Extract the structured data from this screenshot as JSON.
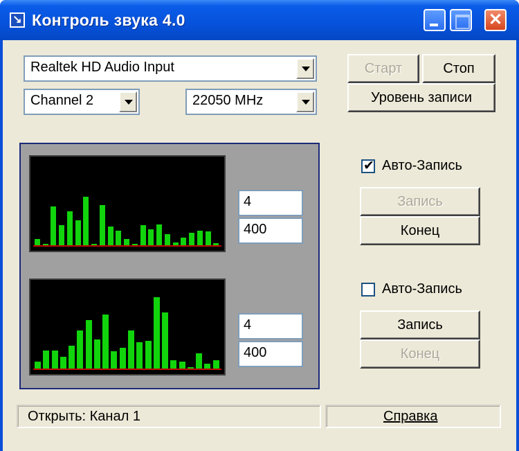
{
  "window": {
    "title": "Контроль звука 4.0",
    "app_icon_glyph": "↘",
    "close_glyph": "✕"
  },
  "device": {
    "selected": "Realtek HD Audio Input"
  },
  "channel": {
    "selected": "Channel 2"
  },
  "sample_rate": {
    "selected": "22050 MHz"
  },
  "buttons": {
    "start": "Старт",
    "stop": "Стоп",
    "record_level": "Уровень записи"
  },
  "channel1": {
    "field_a": "4",
    "field_b": "400",
    "auto_record_label": "Авто-Запись",
    "auto_record_checked": true,
    "record": "Запись",
    "end": "Конец",
    "record_enabled": false,
    "end_enabled": true,
    "levels": [
      0.09,
      0.02,
      0.54,
      0.28,
      0.47,
      0.35,
      0.67,
      0.02,
      0.56,
      0.26,
      0.2,
      0.09,
      0.02,
      0.28,
      0.22,
      0.29,
      0.15,
      0.04,
      0.11,
      0.17,
      0.2,
      0.19,
      0.03
    ]
  },
  "channel2": {
    "field_a": "4",
    "field_b": "400",
    "auto_record_label": "Авто-Запись",
    "auto_record_checked": false,
    "record": "Запись",
    "end": "Конец",
    "record_enabled": true,
    "end_enabled": false,
    "levels": [
      0.1,
      0.25,
      0.25,
      0.16,
      0.32,
      0.53,
      0.67,
      0.4,
      0.75,
      0.24,
      0.29,
      0.53,
      0.37,
      0.38,
      0.99,
      0.78,
      0.12,
      0.1,
      0.0,
      0.21,
      0.07,
      0.12
    ]
  },
  "status_bar": {
    "left": "Открыть: Канал 1",
    "help": "Справка"
  },
  "colors": {
    "title_bar": "#0652db",
    "bar": "#11d40c",
    "baseline": "#c00000",
    "scope_bg": "#000000",
    "panel_bg": "#a0a0a0"
  }
}
